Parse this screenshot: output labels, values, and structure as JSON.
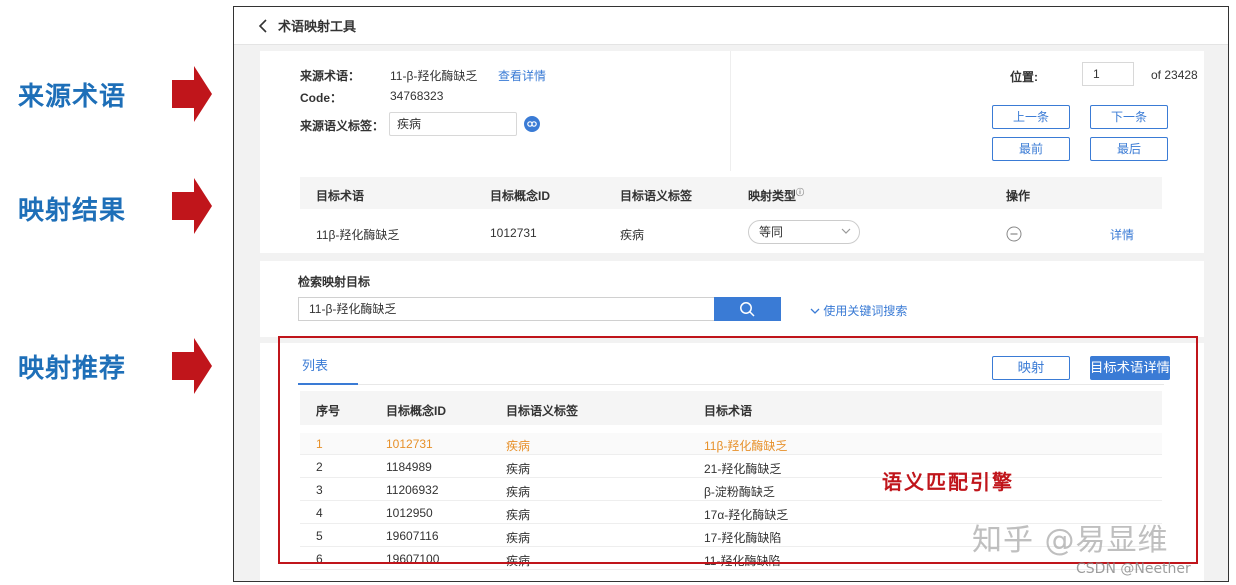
{
  "annotations": {
    "source": "来源术语",
    "result": "映射结果",
    "recommend": "映射推荐",
    "engine": "语义匹配引擎"
  },
  "header": {
    "title": "术语映射工具"
  },
  "source": {
    "term_label": "来源术语：",
    "term_value": "11-β-羟化酶缺乏",
    "detail_link": "查看详情",
    "code_label": "Code：",
    "code_value": "34768323",
    "tag_label": "来源语义标签：",
    "tag_value": "疾病",
    "position_label": "位置:",
    "position_value": "1",
    "total": "of 23428",
    "prev": "上一条",
    "next": "下一条",
    "first": "最前",
    "last": "最后"
  },
  "result": {
    "columns": [
      "目标术语",
      "目标概念ID",
      "目标语义标签",
      "映射类型",
      "操作"
    ],
    "row": {
      "term": "11β-羟化酶缺乏",
      "concept_id": "1012731",
      "tag": "疾病",
      "map_type": "等同",
      "detail": "详情"
    }
  },
  "search": {
    "label": "检索映射目标",
    "value": "11-β-羟化酶缺乏",
    "keyword_link": "使用关键词搜索"
  },
  "recommend": {
    "tab": "列表",
    "map_button": "映射",
    "detail_button": "目标术语详情",
    "columns": [
      "序号",
      "目标概念ID",
      "目标语义标签",
      "目标术语"
    ],
    "rows": [
      {
        "no": "1",
        "id": "1012731",
        "tag": "疾病",
        "term": "11β-羟化酶缺乏"
      },
      {
        "no": "2",
        "id": "1184989",
        "tag": "疾病",
        "term": "21-羟化酶缺乏"
      },
      {
        "no": "3",
        "id": "11206932",
        "tag": "疾病",
        "term": "β-淀粉酶缺乏"
      },
      {
        "no": "4",
        "id": "1012950",
        "tag": "疾病",
        "term": "17α-羟化酶缺乏"
      },
      {
        "no": "5",
        "id": "19607116",
        "tag": "疾病",
        "term": "17-羟化酶缺陷"
      },
      {
        "no": "6",
        "id": "19607100",
        "tag": "疾病",
        "term": "11-羟化酶缺陷"
      }
    ]
  },
  "watermark": {
    "main": "知乎 @易显维",
    "sub": "CSDN @Neether"
  },
  "colors": {
    "accent": "#3a7bd5",
    "annotation": "#1e6fb8",
    "highlight_row": "#e7912b",
    "red": "#c0151b"
  }
}
